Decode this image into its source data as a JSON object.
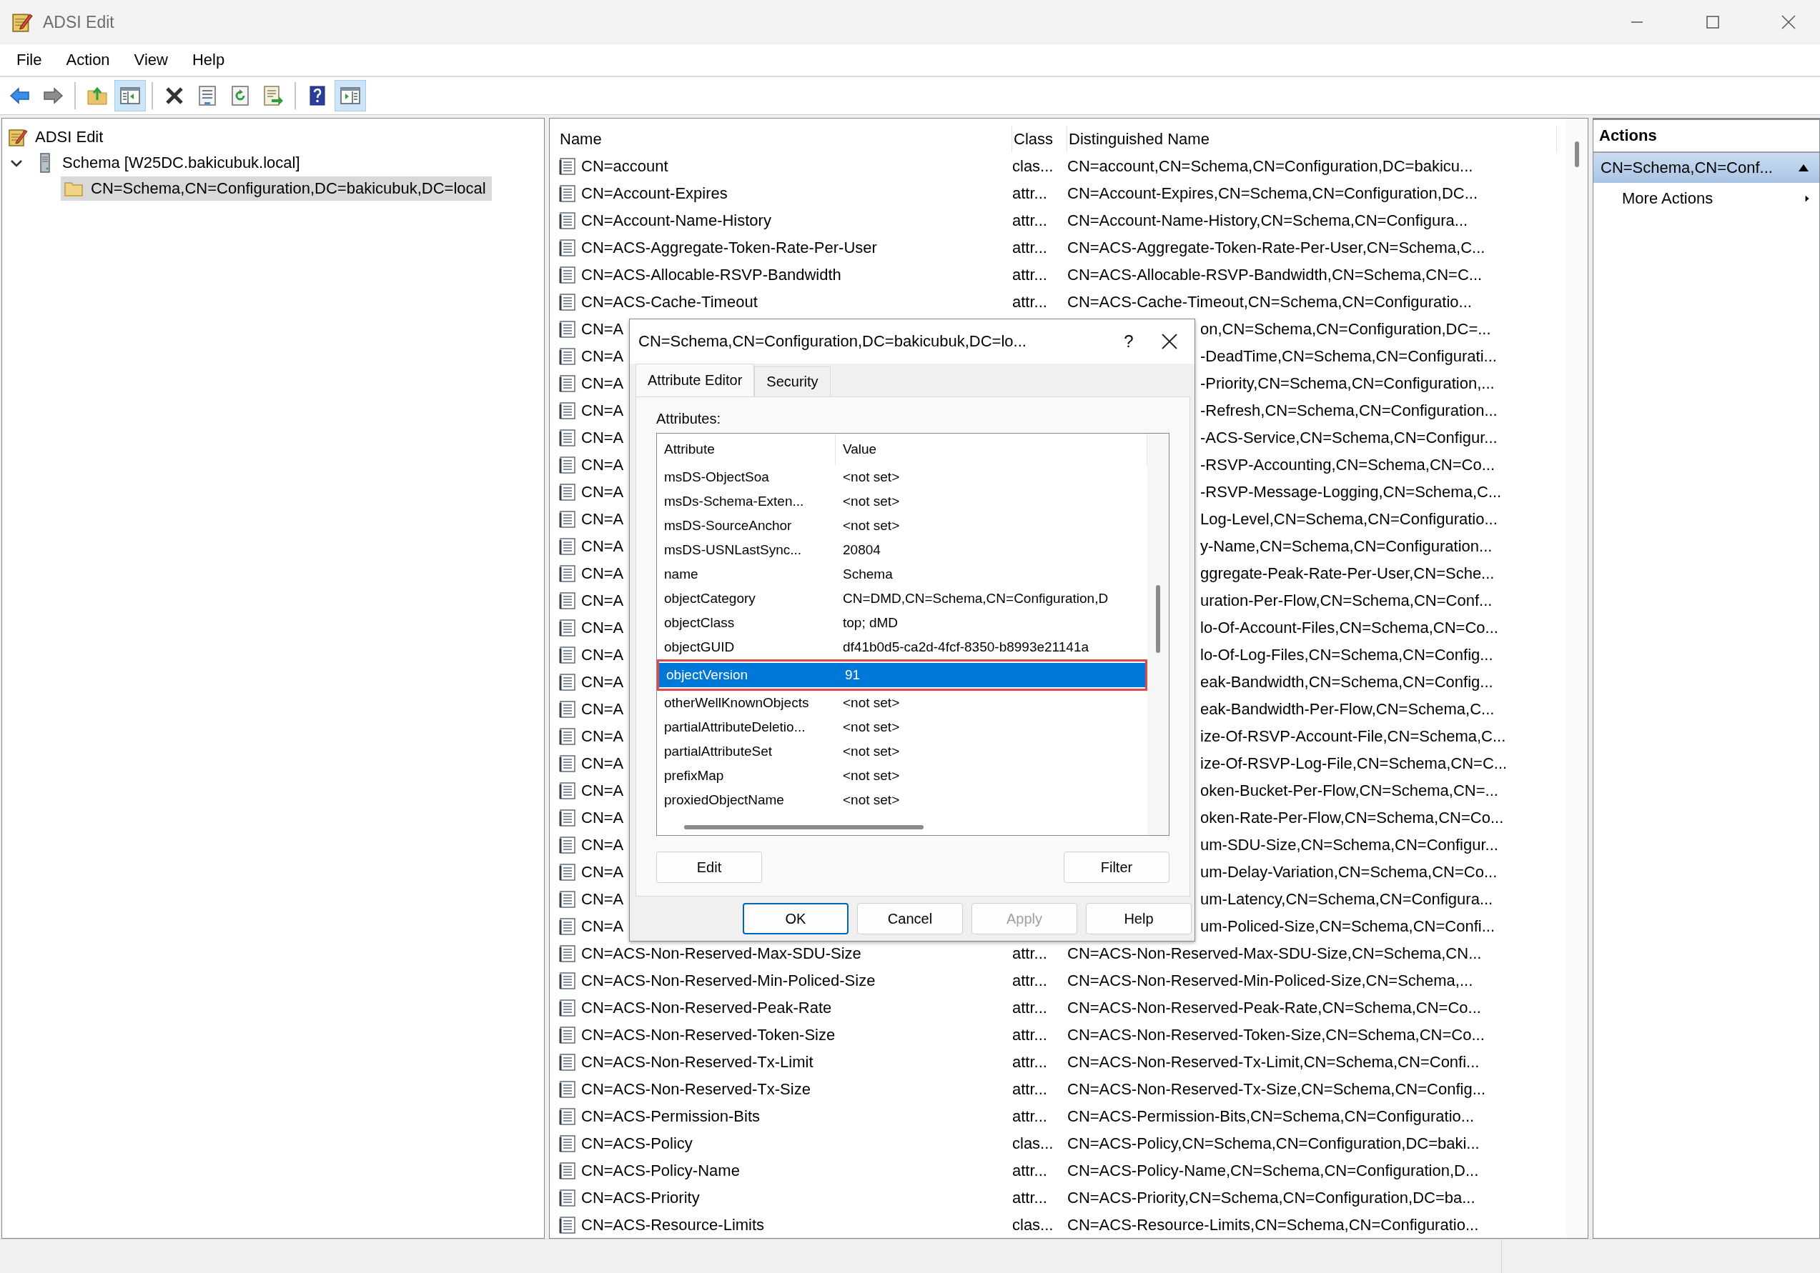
{
  "window": {
    "title": "ADSI Edit"
  },
  "menu": [
    "File",
    "Action",
    "View",
    "Help"
  ],
  "toolbar": [
    [
      {
        "kind": "back",
        "pressed": false
      },
      {
        "kind": "forward",
        "pressed": false
      }
    ],
    [
      {
        "kind": "up",
        "pressed": false
      },
      {
        "kind": "tree-toggle",
        "pressed": true
      }
    ],
    [
      {
        "kind": "delete",
        "pressed": false
      },
      {
        "kind": "properties",
        "pressed": false
      },
      {
        "kind": "refresh",
        "pressed": false
      },
      {
        "kind": "export",
        "pressed": false
      }
    ],
    [
      {
        "kind": "help",
        "pressed": false
      },
      {
        "kind": "pane-toggle",
        "pressed": true
      }
    ]
  ],
  "tree": {
    "items": [
      {
        "label": "ADSI Edit",
        "kind": "root",
        "selected": false,
        "children": [
          {
            "label": "Schema [W25DC.bakicubuk.local]",
            "kind": "server",
            "selected": false,
            "expanded": true,
            "children": [
              {
                "label": "CN=Schema,CN=Configuration,DC=bakicubuk,DC=local",
                "kind": "folder",
                "selected": true
              }
            ]
          }
        ]
      }
    ]
  },
  "list": {
    "columns": [
      "Name",
      "Class",
      "Distinguished Name"
    ],
    "rows": [
      {
        "name": "CN=account",
        "class": "clas...",
        "dn": "CN=account,CN=Schema,CN=Configuration,DC=bakicu..."
      },
      {
        "name": "CN=Account-Expires",
        "class": "attr...",
        "dn": "CN=Account-Expires,CN=Schema,CN=Configuration,DC..."
      },
      {
        "name": "CN=Account-Name-History",
        "class": "attr...",
        "dn": "CN=Account-Name-History,CN=Schema,CN=Configura..."
      },
      {
        "name": "CN=ACS-Aggregate-Token-Rate-Per-User",
        "class": "attr...",
        "dn": "CN=ACS-Aggregate-Token-Rate-Per-User,CN=Schema,C..."
      },
      {
        "name": "CN=ACS-Allocable-RSVP-Bandwidth",
        "class": "attr...",
        "dn": "CN=ACS-Allocable-RSVP-Bandwidth,CN=Schema,CN=C..."
      },
      {
        "name": "CN=ACS-Cache-Timeout",
        "class": "attr...",
        "dn": "CN=ACS-Cache-Timeout,CN=Schema,CN=Configuratio..."
      },
      {
        "name": "CN=A",
        "dn": "on,CN=Schema,CN=Configuration,DC=..."
      },
      {
        "name": "CN=A",
        "dn": "-DeadTime,CN=Schema,CN=Configurati..."
      },
      {
        "name": "CN=A",
        "dn": "-Priority,CN=Schema,CN=Configuration,..."
      },
      {
        "name": "CN=A",
        "dn": "-Refresh,CN=Schema,CN=Configuration..."
      },
      {
        "name": "CN=A",
        "dn": "-ACS-Service,CN=Schema,CN=Configur..."
      },
      {
        "name": "CN=A",
        "dn": "-RSVP-Accounting,CN=Schema,CN=Co..."
      },
      {
        "name": "CN=A",
        "dn": "-RSVP-Message-Logging,CN=Schema,C..."
      },
      {
        "name": "CN=A",
        "dn": "Log-Level,CN=Schema,CN=Configuratio..."
      },
      {
        "name": "CN=A",
        "dn": "y-Name,CN=Schema,CN=Configuration..."
      },
      {
        "name": "CN=A",
        "dn": "ggregate-Peak-Rate-Per-User,CN=Sche..."
      },
      {
        "name": "CN=A",
        "dn": "uration-Per-Flow,CN=Schema,CN=Conf..."
      },
      {
        "name": "CN=A",
        "dn": "lo-Of-Account-Files,CN=Schema,CN=Co..."
      },
      {
        "name": "CN=A",
        "dn": "lo-Of-Log-Files,CN=Schema,CN=Config..."
      },
      {
        "name": "CN=A",
        "dn": "eak-Bandwidth,CN=Schema,CN=Config..."
      },
      {
        "name": "CN=A",
        "dn": "eak-Bandwidth-Per-Flow,CN=Schema,C..."
      },
      {
        "name": "CN=A",
        "dn": "ize-Of-RSVP-Account-File,CN=Schema,C..."
      },
      {
        "name": "CN=A",
        "dn": "ize-Of-RSVP-Log-File,CN=Schema,CN=C..."
      },
      {
        "name": "CN=A",
        "dn": "oken-Bucket-Per-Flow,CN=Schema,CN=..."
      },
      {
        "name": "CN=A",
        "dn": "oken-Rate-Per-Flow,CN=Schema,CN=Co..."
      },
      {
        "name": "CN=A",
        "dn": "um-SDU-Size,CN=Schema,CN=Configur..."
      },
      {
        "name": "CN=A",
        "dn": "um-Delay-Variation,CN=Schema,CN=Co..."
      },
      {
        "name": "CN=A",
        "dn": "um-Latency,CN=Schema,CN=Configura..."
      },
      {
        "name": "CN=A",
        "dn": "um-Policed-Size,CN=Schema,CN=Confi..."
      },
      {
        "name": "CN=ACS-Non-Reserved-Max-SDU-Size",
        "class": "attr...",
        "dn": "CN=ACS-Non-Reserved-Max-SDU-Size,CN=Schema,CN..."
      },
      {
        "name": "CN=ACS-Non-Reserved-Min-Policed-Size",
        "class": "attr...",
        "dn": "CN=ACS-Non-Reserved-Min-Policed-Size,CN=Schema,..."
      },
      {
        "name": "CN=ACS-Non-Reserved-Peak-Rate",
        "class": "attr...",
        "dn": "CN=ACS-Non-Reserved-Peak-Rate,CN=Schema,CN=Co..."
      },
      {
        "name": "CN=ACS-Non-Reserved-Token-Size",
        "class": "attr...",
        "dn": "CN=ACS-Non-Reserved-Token-Size,CN=Schema,CN=Co..."
      },
      {
        "name": "CN=ACS-Non-Reserved-Tx-Limit",
        "class": "attr...",
        "dn": "CN=ACS-Non-Reserved-Tx-Limit,CN=Schema,CN=Confi..."
      },
      {
        "name": "CN=ACS-Non-Reserved-Tx-Size",
        "class": "attr...",
        "dn": "CN=ACS-Non-Reserved-Tx-Size,CN=Schema,CN=Config..."
      },
      {
        "name": "CN=ACS-Permission-Bits",
        "class": "attr...",
        "dn": "CN=ACS-Permission-Bits,CN=Schema,CN=Configuratio..."
      },
      {
        "name": "CN=ACS-Policy",
        "class": "clas...",
        "dn": "CN=ACS-Policy,CN=Schema,CN=Configuration,DC=baki..."
      },
      {
        "name": "CN=ACS-Policy-Name",
        "class": "attr...",
        "dn": "CN=ACS-Policy-Name,CN=Schema,CN=Configuration,D..."
      },
      {
        "name": "CN=ACS-Priority",
        "class": "attr...",
        "dn": "CN=ACS-Priority,CN=Schema,CN=Configuration,DC=ba..."
      },
      {
        "name": "CN=ACS-Resource-Limits",
        "class": "clas...",
        "dn": "CN=ACS-Resource-Limits,CN=Schema,CN=Configuratio..."
      }
    ]
  },
  "actions": {
    "title": "Actions",
    "items": [
      {
        "label": "CN=Schema,CN=Conf...",
        "kind": "section"
      },
      {
        "label": "More Actions",
        "kind": "submenu"
      }
    ]
  },
  "dialog": {
    "title": "CN=Schema,CN=Configuration,DC=bakicubuk,DC=lo...",
    "help": "?",
    "tabs": [
      {
        "label": "Attribute Editor",
        "selected": true
      },
      {
        "label": "Security",
        "selected": false
      }
    ],
    "attributes_label": "Attributes:",
    "columns": [
      "Attribute",
      "Value"
    ],
    "rows": [
      {
        "attribute": "msDS-ObjectSoa",
        "value": "<not set>",
        "selected": false,
        "highlighted": false
      },
      {
        "attribute": "msDs-Schema-Exten...",
        "value": "<not set>",
        "selected": false,
        "highlighted": false
      },
      {
        "attribute": "msDS-SourceAnchor",
        "value": "<not set>",
        "selected": false,
        "highlighted": false
      },
      {
        "attribute": "msDS-USNLastSync...",
        "value": "20804",
        "selected": false,
        "highlighted": false
      },
      {
        "attribute": "name",
        "value": "Schema",
        "selected": false,
        "highlighted": false
      },
      {
        "attribute": "objectCategory",
        "value": "CN=DMD,CN=Schema,CN=Configuration,D",
        "selected": false,
        "highlighted": false
      },
      {
        "attribute": "objectClass",
        "value": "top; dMD",
        "selected": false,
        "highlighted": false
      },
      {
        "attribute": "objectGUID",
        "value": "df41b0d5-ca2d-4fcf-8350-b8993e21141a",
        "selected": false,
        "highlighted": false
      },
      {
        "attribute": "objectVersion",
        "value": "91",
        "selected": true,
        "highlighted": true
      },
      {
        "attribute": "otherWellKnownObjects",
        "value": "<not set>",
        "selected": false,
        "highlighted": false
      },
      {
        "attribute": "partialAttributeDeletio...",
        "value": "<not set>",
        "selected": false,
        "highlighted": false
      },
      {
        "attribute": "partialAttributeSet",
        "value": "<not set>",
        "selected": false,
        "highlighted": false
      },
      {
        "attribute": "prefixMap",
        "value": "<not set>",
        "selected": false,
        "highlighted": false
      },
      {
        "attribute": "proxiedObjectName",
        "value": "<not set>",
        "selected": false,
        "highlighted": false
      }
    ],
    "panel_buttons": [
      {
        "label": "Edit"
      },
      {
        "label": "Filter"
      }
    ],
    "buttons": [
      {
        "label": "OK",
        "default": true,
        "disabled": false
      },
      {
        "label": "Cancel",
        "default": false,
        "disabled": false
      },
      {
        "label": "Apply",
        "default": false,
        "disabled": true
      },
      {
        "label": "Help",
        "default": false,
        "disabled": false
      }
    ]
  }
}
